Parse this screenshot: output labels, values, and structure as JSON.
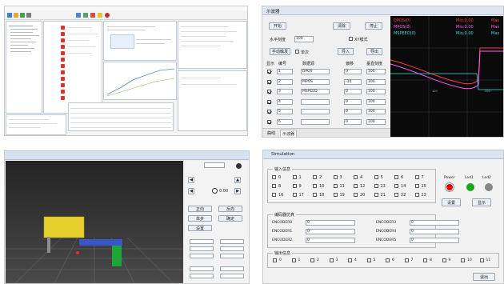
{
  "scope": {
    "title": "示波器",
    "buttons": {
      "start": "开始",
      "export": "清除",
      "stop": "停止",
      "manual": "手动触发",
      "import": "导入",
      "save": "导出"
    },
    "points_label": "水平刻度",
    "points_value": "100",
    "xy_label": "XY模式",
    "single_label": "单次",
    "headers": {
      "show": "显示",
      "id": "编号",
      "source": "数据源",
      "offset": "偏移",
      "scale": "垂直刻度"
    },
    "rows": [
      {
        "id": "1",
        "source": "DPOS",
        "offset": "0",
        "scale": "100",
        "checked": true
      },
      {
        "id": "2",
        "source": "MPOS",
        "offset": "-10",
        "scale": "100",
        "checked": true
      },
      {
        "id": "3",
        "source": "MSPEED",
        "offset": "0",
        "scale": "100",
        "checked": true
      },
      {
        "id": "4",
        "source": "",
        "offset": "0",
        "scale": "100",
        "checked": true
      },
      {
        "id": "5",
        "source": "",
        "offset": "0",
        "scale": "100",
        "checked": true
      },
      {
        "id": "6",
        "source": "",
        "offset": "0",
        "scale": "100",
        "checked": true
      }
    ],
    "tabs": [
      "曲线",
      "示波器"
    ],
    "legend": [
      {
        "text": "DPOS(0)",
        "color": "#ff3b3b"
      },
      {
        "text": "MPOS(0)",
        "color": "#ff5cff"
      },
      {
        "text": "MSPEED(0)",
        "color": "#33e0e0"
      }
    ],
    "readouts": [
      {
        "text": "Min:0.00",
        "color": "#ff3b3b"
      },
      {
        "text": "Min:0.00",
        "color": "#ff5cff"
      },
      {
        "text": "Min:0.00",
        "color": "#33e0e0"
      }
    ],
    "readouts_right": [
      {
        "text": "Max",
        "color": "#ff3b3b"
      },
      {
        "text": "Max",
        "color": "#ff5cff"
      },
      {
        "text": "Max",
        "color": "#33e0e0"
      }
    ],
    "xticks": [
      "100",
      "200"
    ]
  },
  "sim": {
    "title": "Simulation",
    "input_group": "输入信息",
    "inputs": [
      "0",
      "1",
      "2",
      "3",
      "4",
      "5",
      "6",
      "7",
      "8",
      "9",
      "10",
      "11",
      "12",
      "13",
      "14",
      "15",
      "16",
      "17",
      "18",
      "19",
      "20",
      "21",
      "22",
      "23"
    ],
    "led_labels": [
      "Power",
      "Led1",
      "Led2"
    ],
    "led_colors": [
      "#e00000",
      "#18a818",
      "#888888"
    ],
    "set_button": "设置",
    "show_button": "显示",
    "encoder_group": "编码器仿真",
    "encoders": [
      {
        "name": "ENCODER0",
        "value": "0"
      },
      {
        "name": "ENCODER1",
        "value": "0"
      },
      {
        "name": "ENCODER2",
        "value": "0"
      },
      {
        "name": "ENCODER3",
        "value": "0"
      },
      {
        "name": "ENCODER4",
        "value": "0"
      },
      {
        "name": "ENCODER5",
        "value": "0"
      }
    ],
    "output_group": "输出信息",
    "outputs": [
      "0",
      "1",
      "2",
      "3",
      "4",
      "5",
      "6",
      "7",
      "8",
      "9",
      "10",
      "11"
    ],
    "close_button": "退出"
  },
  "robot": {
    "panel_buttons": [
      "正向",
      "反向",
      "单步",
      "确定",
      "设置"
    ],
    "mode_value": "0.00"
  }
}
